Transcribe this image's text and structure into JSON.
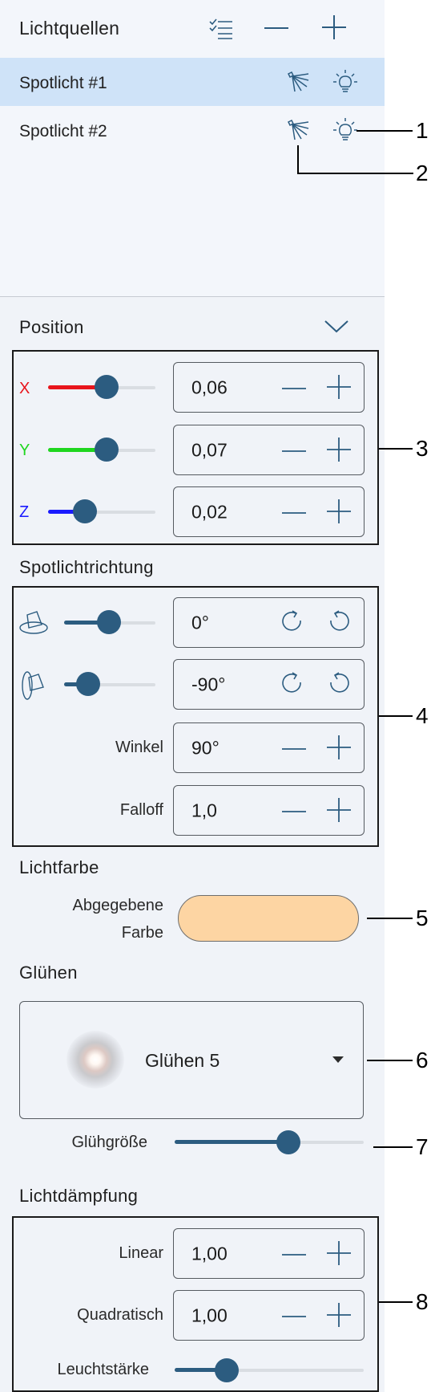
{
  "colors": {
    "accent": "#2c5c80",
    "selected_row": "#cfe3f8",
    "x_axis": "#e8141b",
    "y_axis": "#1fd61f",
    "z_axis": "#1a1aff",
    "light_color": "#fdd5a3"
  },
  "lights": {
    "title": "Lichtquellen",
    "toolbar": {
      "select_icon": "checklist-icon",
      "remove_icon": "minus-icon",
      "add_icon": "plus-icon"
    },
    "items": [
      {
        "label": "Spotlicht #1",
        "selected": true
      },
      {
        "label": "Spotlicht #2",
        "selected": false
      }
    ]
  },
  "position": {
    "title": "Position",
    "axes": [
      {
        "axis": "X",
        "value": "0,06",
        "slider_level": 0.55
      },
      {
        "axis": "Y",
        "value": "0,07",
        "slider_level": 0.55
      },
      {
        "axis": "Z",
        "value": "0,02",
        "slider_level": 0.33
      }
    ]
  },
  "direction": {
    "title": "Spotlichtrichtung",
    "rot1": {
      "value": "0°",
      "slider_level": 0.5
    },
    "rot2": {
      "value": "-90°",
      "slider_level": 0.25
    },
    "angle_label": "Winkel",
    "angle_value": "90°",
    "falloff_label": "Falloff",
    "falloff_value": "1,0"
  },
  "color": {
    "title": "Lichtfarbe",
    "label_line1": "Abgegebene",
    "label_line2": "Farbe",
    "swatch": "#fdd5a3"
  },
  "glow": {
    "title": "Glühen",
    "selected": "Glühen 5",
    "size_label": "Glühgröße",
    "size_level": 0.6
  },
  "attenuation": {
    "title": "Lichtdämpfung",
    "linear_label": "Linear",
    "linear_value": "1,00",
    "quadratic_label": "Quadratisch",
    "quadratic_value": "1,00",
    "intensity_label": "Leuchtstärke",
    "intensity_level": 0.28
  },
  "callouts": [
    "1",
    "2",
    "3",
    "4",
    "5",
    "6",
    "7",
    "8"
  ]
}
